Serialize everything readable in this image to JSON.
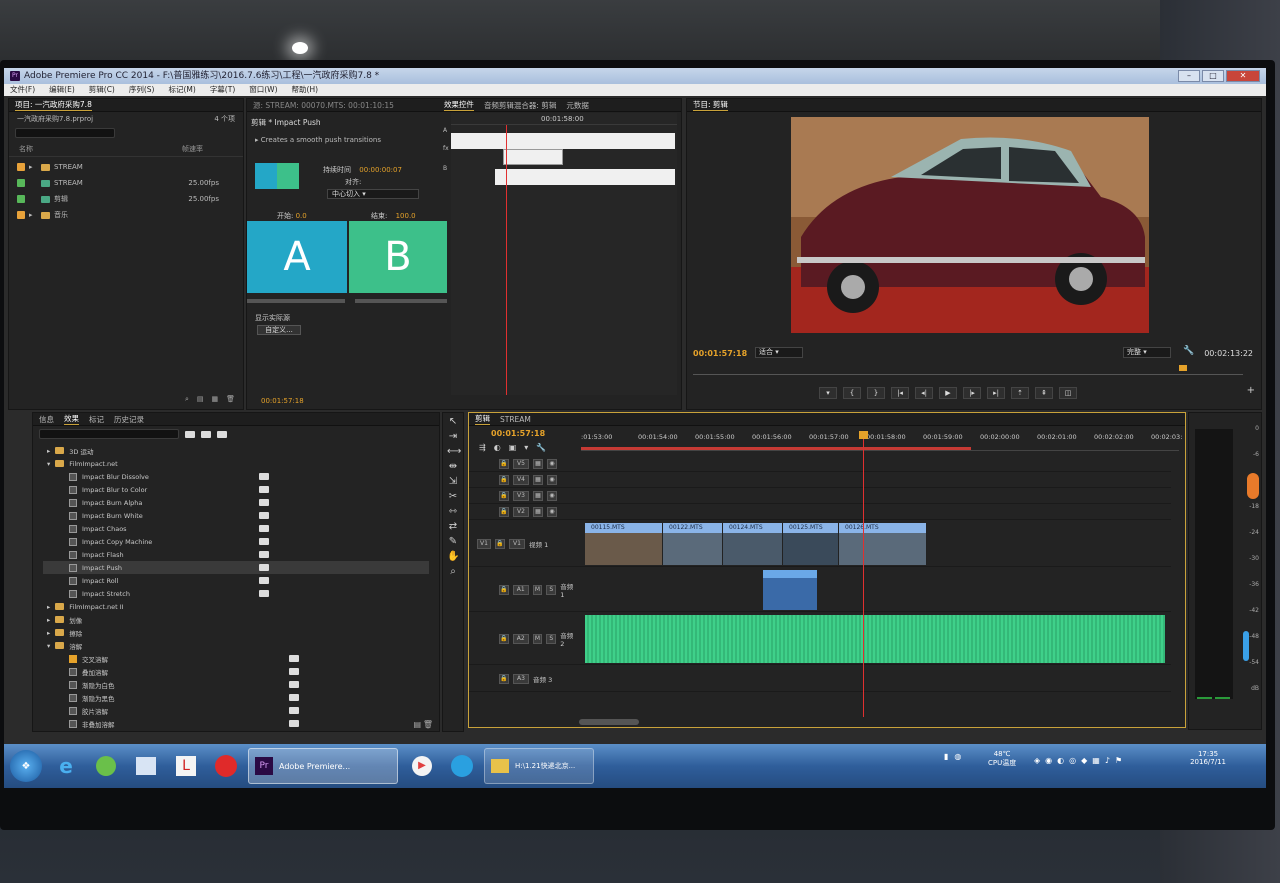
{
  "window": {
    "title": "Adobe Premiere Pro CC 2014 - F:\\普国雅练习\\2016.7.6练习\\工程\\一汽政府采购7.8 *",
    "app_icon": "premiere-icon"
  },
  "menu": [
    "文件(F)",
    "编辑(E)",
    "剪辑(C)",
    "序列(S)",
    "标记(M)",
    "字幕(T)",
    "窗口(W)",
    "帮助(H)"
  ],
  "project": {
    "tab": "项目: 一汽政府采购7.8",
    "file": "一汽政府采购7.8.prproj",
    "count": "4 个项",
    "col_name": "名称",
    "col_fps": "帧速率",
    "items": [
      {
        "name": "STREAM",
        "fps": "",
        "color": "#e8a23a",
        "type": "folder"
      },
      {
        "name": "STREAM",
        "fps": "25.00fps",
        "color": "#58b85a",
        "type": "sequence"
      },
      {
        "name": "剪辑",
        "fps": "25.00fps",
        "color": "#58b85a",
        "type": "sequence"
      },
      {
        "name": "音乐",
        "fps": "",
        "color": "#e8a23a",
        "type": "folder"
      }
    ]
  },
  "effect_controls": {
    "source_label": "源: STREAM: 00070.MTS: 00:01:10:15",
    "tab_active": "效果控件",
    "tab_mixer": "音频剪辑混合器: 剪辑",
    "tab_meta": "元数据",
    "clip_label": "剪辑 * Impact Push",
    "desc": "Creates a smooth push transitions",
    "duration_label": "持续时间",
    "duration_value": "00:00:00:07",
    "align_label": "对齐:",
    "align_value": "中心切入",
    "start_label": "开始:",
    "start_value": "0.0",
    "end_label": "结束:",
    "end_value": "100.0",
    "a": "A",
    "b": "B",
    "show_source": "显示实际源",
    "custom": "自定义...",
    "timecode": "00:01:57:18",
    "ruler_time": "00:01:58:00",
    "lane_a": "A",
    "lane_b": "B",
    "fx": "fx"
  },
  "program": {
    "tab": "节目: 剪辑",
    "timecode": "00:01:57:18",
    "fit": "适合",
    "quality": "完整",
    "duration": "00:02:13:22"
  },
  "effects": {
    "tabs": [
      "信息",
      "效果",
      "标记",
      "历史记录"
    ],
    "tree": [
      {
        "label": "3D 运动",
        "level": 1,
        "kind": "folder"
      },
      {
        "label": "FilmImpact.net",
        "level": 1,
        "kind": "folder-open"
      },
      {
        "label": "Impact Blur Dissolve",
        "level": 2,
        "kind": "fx"
      },
      {
        "label": "Impact Blur to Color",
        "level": 2,
        "kind": "fx"
      },
      {
        "label": "Impact Burn Alpha",
        "level": 2,
        "kind": "fx"
      },
      {
        "label": "Impact Burn White",
        "level": 2,
        "kind": "fx"
      },
      {
        "label": "Impact Chaos",
        "level": 2,
        "kind": "fx"
      },
      {
        "label": "Impact Copy Machine",
        "level": 2,
        "kind": "fx"
      },
      {
        "label": "Impact Flash",
        "level": 2,
        "kind": "fx"
      },
      {
        "label": "Impact Push",
        "level": 2,
        "kind": "fx",
        "selected": true
      },
      {
        "label": "Impact Roll",
        "level": 2,
        "kind": "fx"
      },
      {
        "label": "Impact Stretch",
        "level": 2,
        "kind": "fx"
      },
      {
        "label": "FilmImpact.net II",
        "level": 1,
        "kind": "folder"
      },
      {
        "label": "划像",
        "level": 1,
        "kind": "folder"
      },
      {
        "label": "擦除",
        "level": 1,
        "kind": "folder"
      },
      {
        "label": "溶解",
        "level": 1,
        "kind": "folder-open"
      },
      {
        "label": "交叉溶解",
        "level": 2,
        "kind": "fx-orange"
      },
      {
        "label": "叠加溶解",
        "level": 2,
        "kind": "fx"
      },
      {
        "label": "渐隐为白色",
        "level": 2,
        "kind": "fx"
      },
      {
        "label": "渐隐为黑色",
        "level": 2,
        "kind": "fx"
      },
      {
        "label": "胶片溶解",
        "level": 2,
        "kind": "fx"
      },
      {
        "label": "非叠加溶解",
        "level": 2,
        "kind": "fx"
      }
    ]
  },
  "timeline": {
    "tabs": [
      "剪辑",
      "STREAM"
    ],
    "timecode": "00:01:57:18",
    "ruler": [
      ":01:53:00",
      "00:01:54:00",
      "00:01:55:00",
      "00:01:56:00",
      "00:01:57:00",
      "00:01:58:00",
      "00:01:59:00",
      "00:02:00:00",
      "00:02:01:00",
      "00:02:02:00",
      "00:02:03:"
    ],
    "video_tracks": [
      "V5",
      "V4",
      "V3",
      "V2"
    ],
    "v1_src": "V1",
    "v1": "V1",
    "v1_name": "视频 1",
    "a1": "A1",
    "a1_name": "音频 1",
    "a2": "A2",
    "a2_name": "音频 2",
    "a3": "A3",
    "a3_name": "音频 3",
    "m": "M",
    "s": "S",
    "clips": [
      "00115.MTS",
      "00122.MTS",
      "00124.MTS",
      "00125.MTS",
      "00126.MTS"
    ]
  },
  "meter": {
    "labels": [
      "0",
      "-6",
      "-12",
      "-18",
      "-24",
      "-30",
      "-36",
      "-42",
      "-48",
      "-54",
      "dB"
    ]
  },
  "taskbar": {
    "apps": [
      "start-orb-icon",
      "ie-icon",
      "browser-icon",
      "explorer-icon",
      "app-icon",
      "netease-music-icon"
    ],
    "premiere_label": "Adobe Premiere...",
    "folder_label": "H:\\1.21快递北京...",
    "temp": "48℃",
    "temp_label": "CPU温度",
    "time": "17:35",
    "date": "2016/7/11"
  }
}
